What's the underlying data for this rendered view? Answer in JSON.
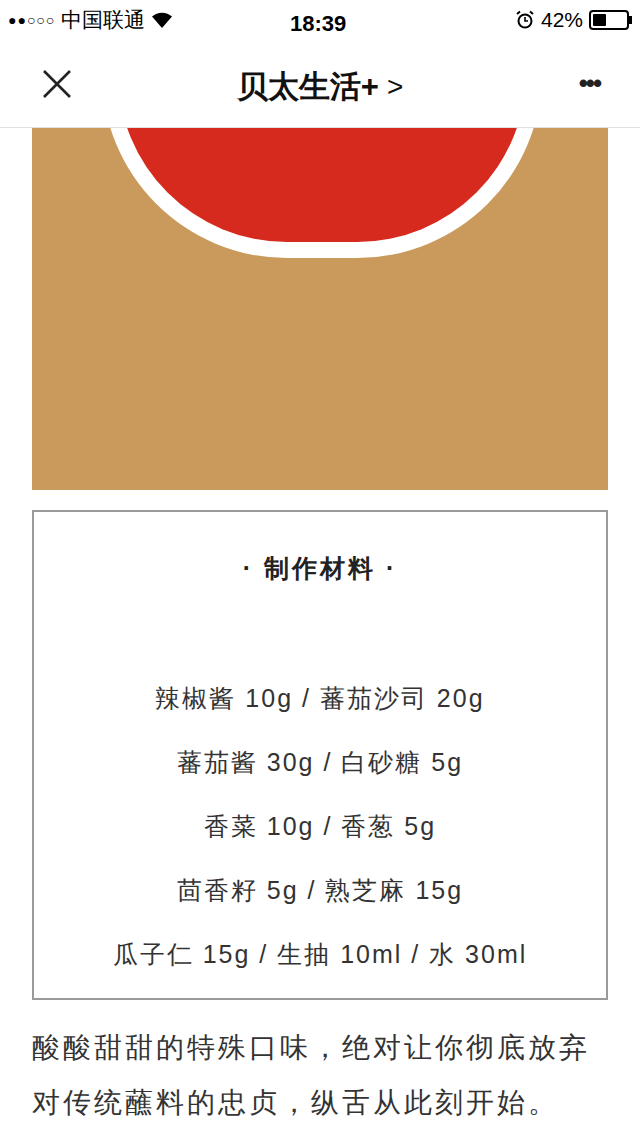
{
  "status_bar": {
    "signal": "●●○○○",
    "carrier": "中国联通",
    "time": "18:39",
    "battery": "42%",
    "battery_level": 0.42
  },
  "nav": {
    "title": "贝太生活+",
    "chevron": ">",
    "more": "•••"
  },
  "ingredients": {
    "title": "· 制作材料 ·",
    "rows": [
      "辣椒酱 10g / 蕃茄沙司 20g",
      "蕃茄酱 30g / 白砂糖 5g",
      "香菜 10g / 香葱 5g",
      "茴香籽 5g / 熟芝麻 15g",
      "瓜子仁 15g / 生抽 10ml / 水 30ml"
    ]
  },
  "description": "酸酸甜甜的特殊口味，绝对让你彻底放弃对传统蘸料的忠贞，纵舌从此刻开始。"
}
